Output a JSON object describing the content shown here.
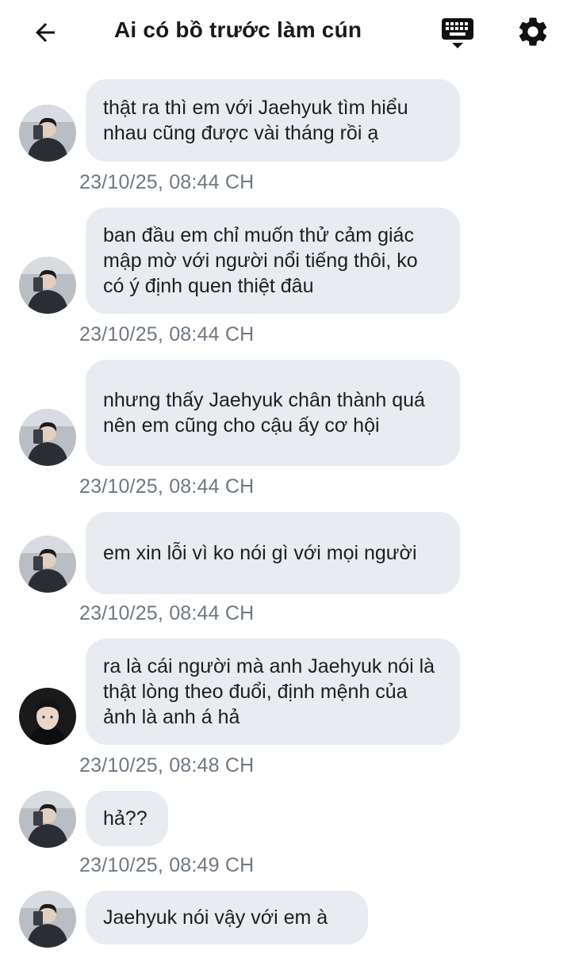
{
  "header": {
    "title": "Ai có bồ trước làm cún",
    "back_icon": "arrow-left-icon",
    "keyboard_icon": "keyboard-icon",
    "settings_icon": "gear-icon"
  },
  "messages": [
    {
      "text": "thật ra thì em với Jaehyuk tìm hiểu nhau cũng được vài tháng rồi ạ",
      "time": "23/10/25, 08:44 CH",
      "avatar": "avatar-boy-mirror-selfie"
    },
    {
      "text": "ban đầu em chỉ muốn thử cảm giác mập mờ với người nổi tiếng thôi, ko có ý định quen thiệt đâu",
      "time": "23/10/25, 08:44 CH",
      "avatar": "avatar-boy-mirror-selfie"
    },
    {
      "text": "nhưng thấy Jaehyuk chân thành quá nên em cũng cho cậu ấy cơ hội",
      "time": "23/10/25, 08:44 CH",
      "avatar": "avatar-boy-mirror-selfie"
    },
    {
      "text": "em xin lỗi vì ko nói gì với mọi người",
      "time": "23/10/25, 08:44 CH",
      "avatar": "avatar-boy-mirror-selfie"
    },
    {
      "text": "ra là cái người mà anh Jaehyuk nói là thật lòng theo đuổi, định mệnh của ảnh là anh á hả",
      "time": "23/10/25, 08:48 CH",
      "avatar": "avatar-boy-portrait"
    },
    {
      "text": "hả??",
      "time": "23/10/25, 08:49 CH",
      "avatar": "avatar-boy-mirror-selfie"
    },
    {
      "text": "Jaehyuk nói vậy với em à",
      "time": "",
      "avatar": "avatar-boy-mirror-selfie"
    }
  ],
  "colors": {
    "bubble": "#e8ebef",
    "timestamp": "#6e7882",
    "text": "#1e1e1e"
  }
}
